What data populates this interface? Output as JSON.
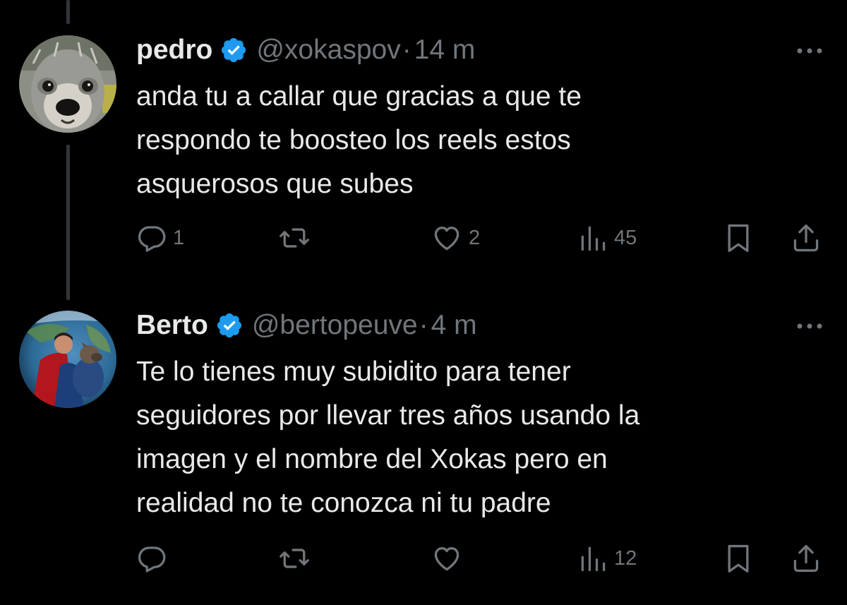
{
  "colors": {
    "background": "#000000",
    "text": "#e7e9ea",
    "muted": "#71767b",
    "verified_badge": "#1d9bf0",
    "thread_line": "#333639"
  },
  "tweets": [
    {
      "avatar_icon": "dog-face-avatar",
      "name": "pedro",
      "verified_icon": "verified-badge-icon",
      "handle": "@xokaspov",
      "separator": "·",
      "time": "14 m",
      "text_lines": [
        "anda tu a callar que gracias a que te",
        "respondo te boosteo los reels estos",
        "asquerosos que subes"
      ],
      "replies": "1",
      "reposts": "",
      "likes": "2",
      "views": "45"
    },
    {
      "avatar_icon": "superhero-with-dog-avatar",
      "name": "Berto",
      "verified_icon": "verified-badge-icon",
      "handle": "@bertopeuve",
      "separator": "·",
      "time": "4 m",
      "text_lines": [
        "Te lo tienes muy subidito para tener",
        "seguidores por llevar tres años usando la",
        "imagen y el nombre del Xokas pero en",
        "realidad no te conozca ni tu padre"
      ],
      "replies": "",
      "reposts": "",
      "likes": "",
      "views": "12"
    }
  ]
}
